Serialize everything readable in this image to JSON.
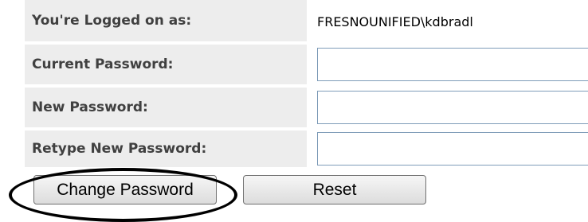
{
  "form": {
    "logged_on_label": "You're Logged on as:",
    "logged_on_value": "FRESNOUNIFIED\\kdbradl",
    "current_password_label": "Current Password:",
    "current_password_value": "",
    "new_password_label": "New Password:",
    "new_password_value": "",
    "retype_password_label": "Retype New Password:",
    "retype_password_value": ""
  },
  "buttons": {
    "change_password_label": "Change Password",
    "reset_label": "Reset"
  },
  "annotation": {
    "highlight": "change-password-button",
    "color": "#000000"
  }
}
